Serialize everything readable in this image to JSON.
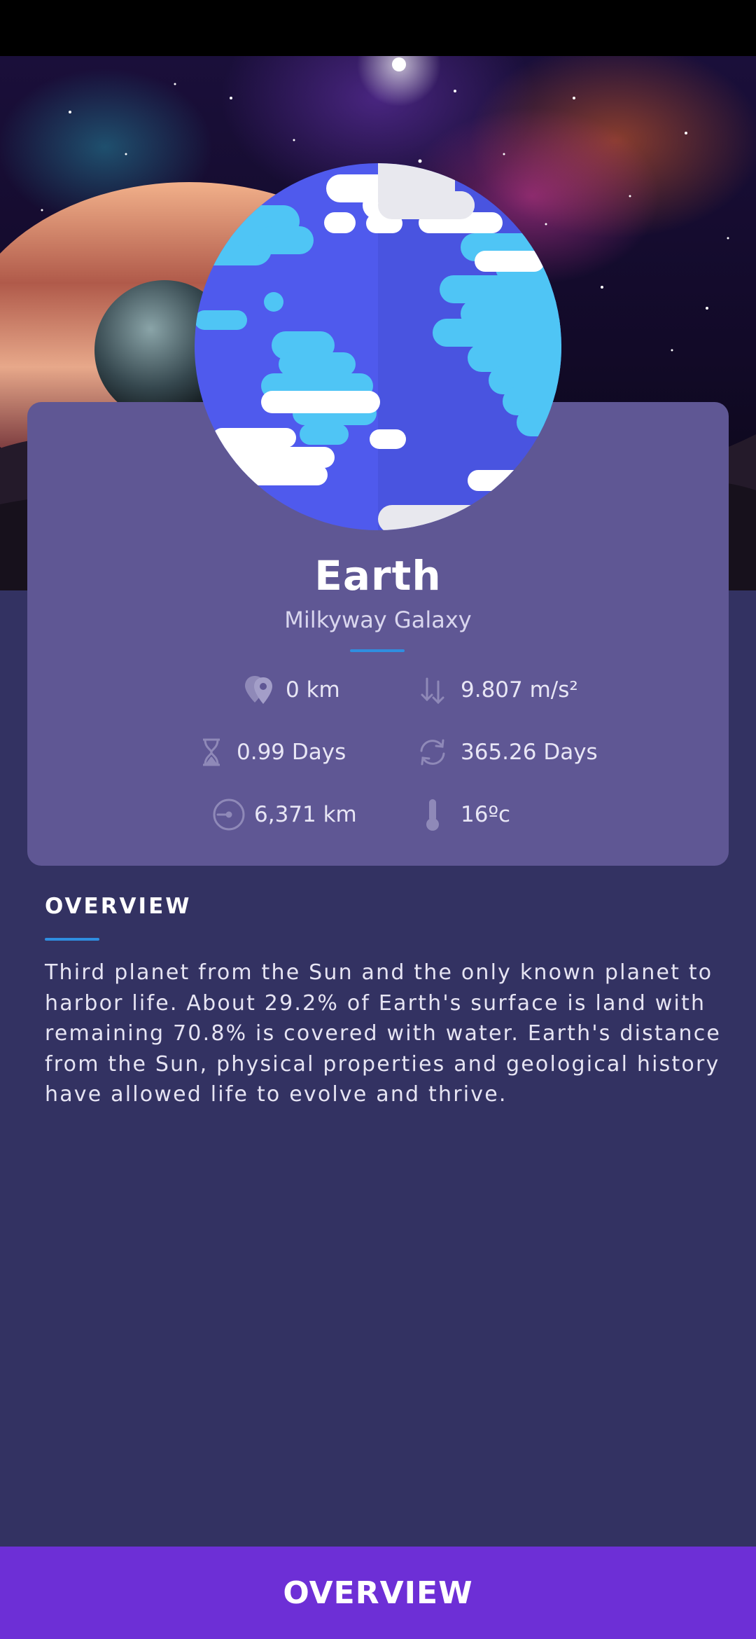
{
  "planet": {
    "name": "Earth",
    "galaxy": "Milkyway Galaxy"
  },
  "stats": {
    "distance": "0 km",
    "gravity": "9.807 m/s²",
    "day_length": "0.99 Days",
    "orbital_period": "365.26 Days",
    "radius": "6,371 km",
    "temperature": "16ºc"
  },
  "icons": {
    "distance": "map-pin-icon",
    "gravity": "gravity-arrows-icon",
    "day_length": "hourglass-icon",
    "orbital_period": "rotate-icon",
    "radius": "radius-icon",
    "temperature": "thermometer-icon"
  },
  "overview": {
    "heading": "OVERVIEW",
    "text": "Third planet from the Sun and the only known planet to harbor life. About 29.2% of Earth's surface is land with remaining 70.8% is covered with water. Earth's distance from the Sun, physical properties and geological history have allowed life to evolve and thrive."
  },
  "bottom_button": {
    "label": "OVERVIEW"
  },
  "colors": {
    "background": "#333262",
    "card": "#5f5794",
    "accent_divider": "#2f8ee0",
    "button": "#6d2fd6"
  }
}
